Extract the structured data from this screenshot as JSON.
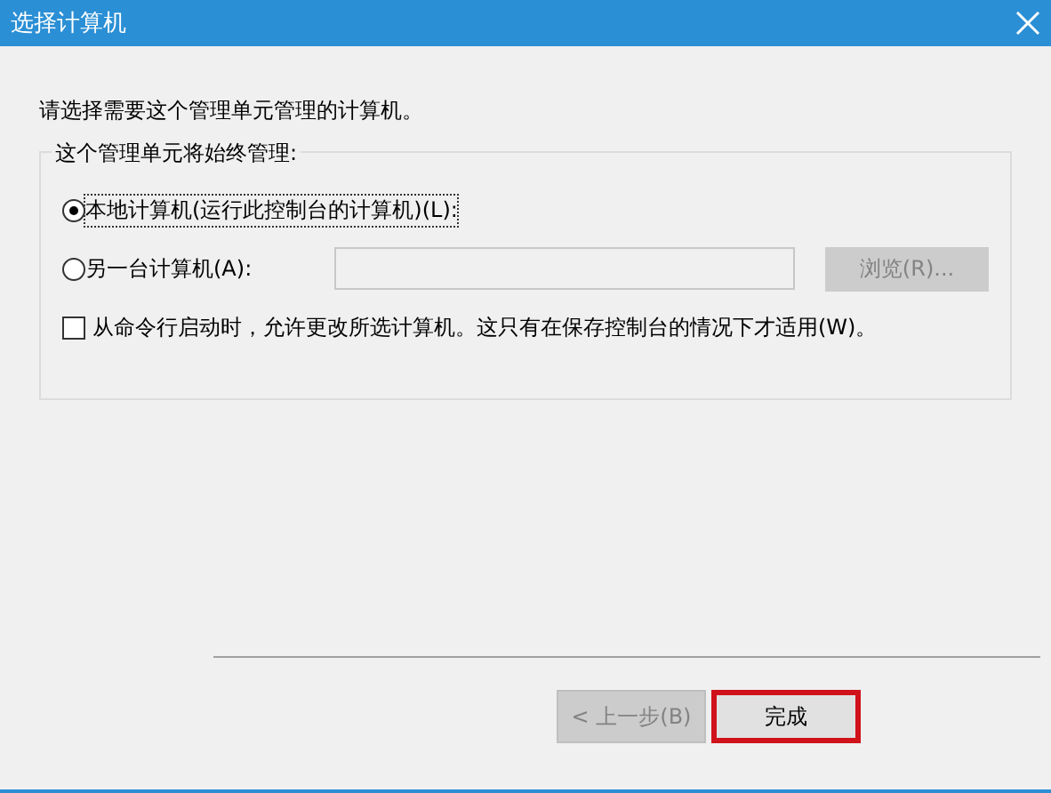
{
  "window": {
    "title": "选择计算机"
  },
  "prompt": "请选择需要这个管理单元管理的计算机。",
  "group": {
    "title": "这个管理单元将始终管理:",
    "options": [
      {
        "label": "本地计算机(运行此控制台的计算机)(L):",
        "selected": true
      },
      {
        "label": "另一台计算机(A):",
        "selected": false
      }
    ],
    "browse_button": {
      "label": "浏览(R)...",
      "disabled": true
    },
    "allow_change": {
      "label": "从命令行启动时，允许更改所选计算机。这只有在保存控制台的情况下才适用(W)。",
      "checked": false
    }
  },
  "buttons": [
    {
      "label": "< 上一步(B)",
      "disabled": true,
      "highlighted": false
    },
    {
      "label": "完成",
      "disabled": false,
      "highlighted": true
    }
  ]
}
